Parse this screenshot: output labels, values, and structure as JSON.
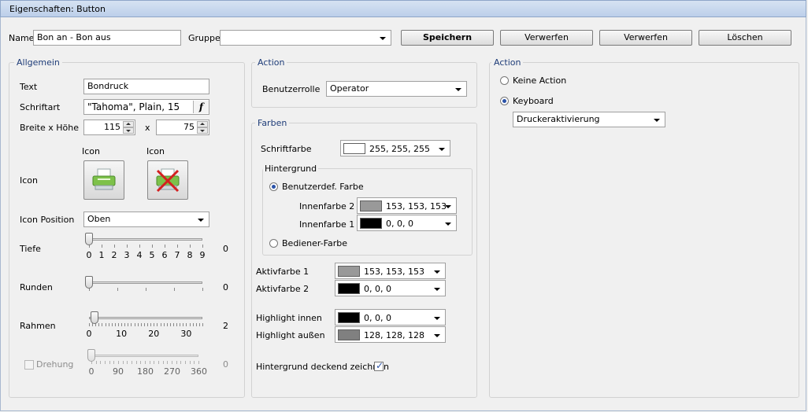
{
  "window": {
    "title": "Eigenschaften: Button"
  },
  "header": {
    "name_label": "Name",
    "name_value": "Bon an - Bon aus",
    "group_label": "Gruppe",
    "group_value": "",
    "save_label": "Speichern",
    "discard1_label": "Verwerfen",
    "discard2_label": "Verwerfen",
    "delete_label": "Löschen"
  },
  "general": {
    "title": "Allgemein",
    "text_label": "Text",
    "text_value": "Bondruck",
    "font_label": "Schriftart",
    "font_value": "\"Tahoma\", Plain, 15",
    "font_button": "f",
    "size_label": "Breite x Höhe",
    "width_value": "115",
    "x_label": "x",
    "height_value": "75",
    "icon_header1": "Icon",
    "icon_header2": "Icon",
    "icon_label": "Icon",
    "icon_position_label": "Icon Position",
    "icon_position_value": "Oben",
    "depth": {
      "label": "Tiefe",
      "value": "0",
      "min": 0,
      "max": 9,
      "current": 0,
      "ticks": [
        "0",
        "1",
        "2",
        "3",
        "4",
        "5",
        "6",
        "7",
        "8",
        "9"
      ]
    },
    "round": {
      "label": "Runden",
      "value": "0",
      "current": 0
    },
    "frame": {
      "label": "Rahmen",
      "value": "2",
      "min": 0,
      "max": 40,
      "current": 2,
      "ticks": [
        "0",
        "10",
        "20",
        "30"
      ]
    },
    "rotation": {
      "label": "Drehung",
      "value": "0",
      "min": 0,
      "max": 360,
      "current": 0,
      "ticks": [
        "0",
        "90",
        "180",
        "270",
        "360"
      ],
      "enabled": false,
      "checked": false
    }
  },
  "action_mid": {
    "title": "Action",
    "role_label": "Benutzerrolle",
    "role_value": "Operator"
  },
  "colors": {
    "title": "Farben",
    "font_color_label": "Schriftfarbe",
    "font_color_value": "255, 255, 255",
    "font_color_hex": "#ffffff",
    "bg_title": "Hintergrund",
    "custom_color_label": "Benutzerdef. Farbe",
    "inner2_label": "Innenfarbe 2",
    "inner2_value": "153, 153, 153",
    "inner2_hex": "#999999",
    "inner1_label": "Innenfarbe 1",
    "inner1_value": "0, 0, 0",
    "inner1_hex": "#000000",
    "operator_color_label": "Bediener-Farbe",
    "active1_label": "Aktivfarbe 1",
    "active1_value": "153, 153, 153",
    "active1_hex": "#999999",
    "active2_label": "Aktivfarbe 2",
    "active2_value": "0, 0, 0",
    "active2_hex": "#000000",
    "hl_inner_label": "Highlight innen",
    "hl_inner_value": "0, 0, 0",
    "hl_inner_hex": "#000000",
    "hl_outer_label": "Highlight außen",
    "hl_outer_value": "128, 128, 128",
    "hl_outer_hex": "#808080",
    "opaque_label": "Hintergrund deckend zeichnen"
  },
  "action_right": {
    "title": "Action",
    "no_action_label": "Keine Action",
    "keyboard_label": "Keyboard",
    "keyboard_value": "Druckeraktivierung"
  }
}
